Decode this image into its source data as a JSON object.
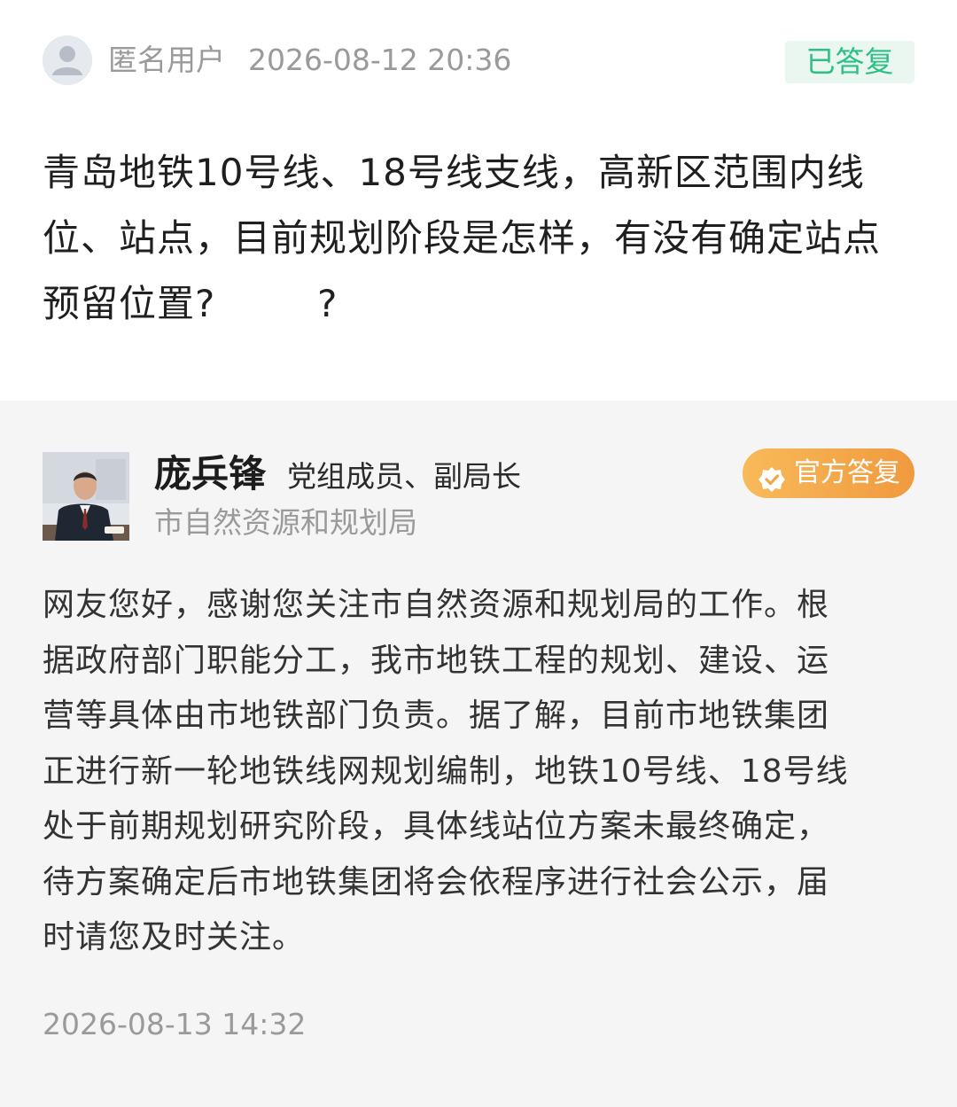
{
  "question": {
    "user": "匿名用户",
    "time": "2026-08-12 20:36",
    "status": "已答复",
    "text": "青岛地铁10号线、18号线支线，高新区范围内线\n位、站点，目前规划阶段是怎样，有没有确定站点\n预留位置?        ?"
  },
  "answer": {
    "name": "庞兵锋",
    "title": "党组成员、副局长",
    "department": "市自然资源和规划局",
    "badge": "官方答复",
    "text": "网友您好，感谢您关注市自然资源和规划局的工作。根\n据政府部门职能分工，我市地铁工程的规划、建设、运\n营等具体由市地铁部门负责。据了解，目前市地铁集团\n正进行新一轮地铁线网规划编制，地铁10号线、18号线\n处于前期规划研究阶段，具体线站位方案未最终确定，\n待方案确定后市地铁集团将会依程序进行社会公示，届\n时请您及时关注。",
    "time": "2026-08-13 14:32"
  },
  "icons": {
    "anonymous_avatar": "user-silhouette-icon",
    "official_badge": "verified-check-icon"
  },
  "colors": {
    "status_green": "#2fbf86",
    "badge_orange": "#f09a3e",
    "answer_bg": "#f5f5f5"
  }
}
